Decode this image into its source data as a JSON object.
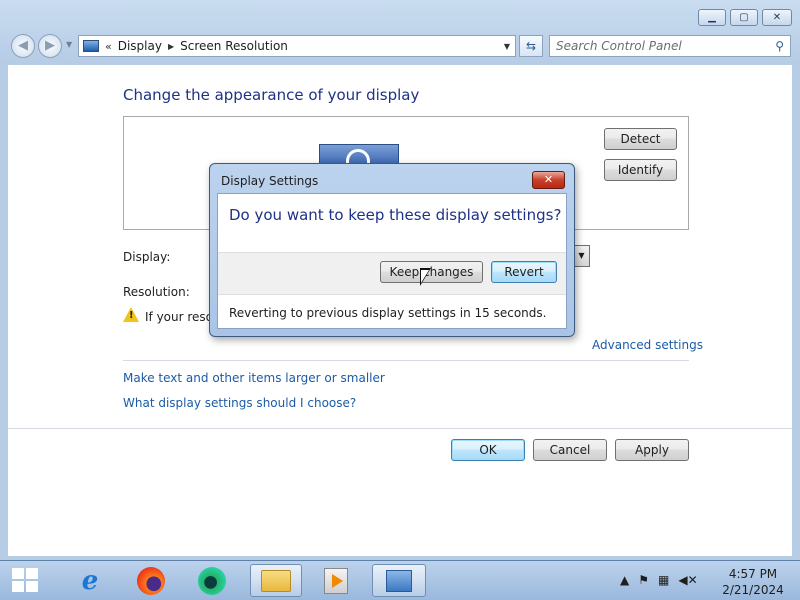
{
  "window": {
    "controls": {
      "minimize": "▁",
      "maximize": "▢",
      "close": "✕"
    }
  },
  "nav": {
    "back_icon": "arrow-left-icon",
    "forward_icon": "arrow-right-icon",
    "address": {
      "overflow": "«",
      "crumbs": [
        "Display",
        "Screen Resolution"
      ]
    },
    "search": {
      "placeholder": "Search Control Panel"
    }
  },
  "main": {
    "heading": "Change the appearance of your display",
    "detect_label": "Detect",
    "identify_label": "Identify",
    "display_label": "Display:",
    "resolution_label": "Resolution:",
    "warning_text": "If your resolu",
    "advanced_link": "Advanced settings",
    "link_text_size": "Make text and other items larger or smaller",
    "link_help": "What display settings should I choose?",
    "ok_label": "OK",
    "cancel_label": "Cancel",
    "apply_label": "Apply"
  },
  "dialog": {
    "title": "Display Settings",
    "close_label": "✕",
    "question": "Do you want to keep these display settings?",
    "keep_label": "Keep changes",
    "revert_label": "Revert",
    "status": "Reverting to previous display settings in 15 seconds."
  },
  "taskbar": {
    "apps": [
      "internet-explorer",
      "firefox",
      "edge",
      "file-explorer",
      "media-player",
      "control-panel"
    ],
    "tray_icons": [
      "chevron-up-icon",
      "flag-icon",
      "network-icon",
      "volume-muted-icon"
    ],
    "time": "4:57 PM",
    "date": "2/21/2024"
  }
}
